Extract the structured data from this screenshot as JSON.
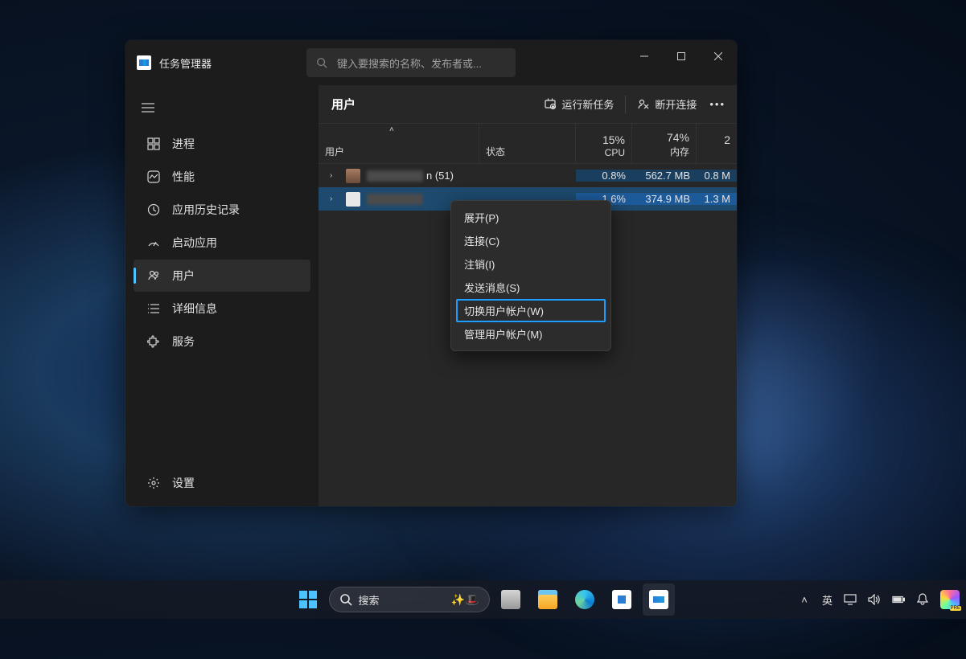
{
  "app": {
    "title": "任务管理器",
    "search_placeholder": "键入要搜索的名称、发布者或..."
  },
  "sidebar": {
    "items": [
      {
        "label": "进程"
      },
      {
        "label": "性能"
      },
      {
        "label": "应用历史记录"
      },
      {
        "label": "启动应用"
      },
      {
        "label": "用户"
      },
      {
        "label": "详细信息"
      },
      {
        "label": "服务"
      }
    ],
    "settings_label": "设置"
  },
  "main": {
    "title": "用户",
    "run_new_task": "运行新任务",
    "disconnect": "断开连接",
    "columns": {
      "user": "用户",
      "status": "状态",
      "cpu_pct": "15%",
      "cpu_label": "CPU",
      "mem_pct": "74%",
      "mem_label": "内存",
      "extra": "2"
    },
    "rows": [
      {
        "suffix": "n (51)",
        "cpu": "0.8%",
        "mem": "562.7 MB",
        "extra": "0.8 M"
      },
      {
        "suffix": "",
        "cpu": "1.6%",
        "mem": "374.9 MB",
        "extra": "1.3 M"
      }
    ]
  },
  "context_menu": {
    "items": [
      "展开(P)",
      "连接(C)",
      "注销(I)",
      "发送消息(S)",
      "切换用户帐户(W)",
      "管理用户帐户(M)"
    ],
    "highlighted_index": 4
  },
  "taskbar": {
    "search_label": "搜索",
    "ime": "英"
  }
}
